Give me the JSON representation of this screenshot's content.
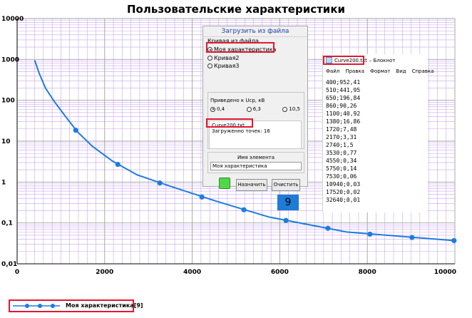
{
  "chart_data": {
    "type": "line",
    "title": "Пользовательские характеристики",
    "xlabel": "",
    "ylabel": "",
    "x_scale": "linear",
    "y_scale": "log",
    "xlim": [
      0,
      10000
    ],
    "ylim": [
      0.01,
      10000
    ],
    "x_ticks": [
      "0",
      "2000",
      "4000",
      "6000",
      "8000",
      "10000"
    ],
    "y_ticks": [
      "0,01",
      "0,1",
      "1",
      "10",
      "100",
      "1000",
      "10000"
    ],
    "grid": true,
    "legend_position": "bottom-left",
    "series": [
      {
        "name": "Моя характеристика[9]",
        "color": "#1e7be0",
        "x": [
          400,
          510,
          650,
          860,
          1100,
          1380,
          1720,
          2170,
          2740,
          3530,
          4550,
          5750,
          7530,
          10940,
          17520,
          32640
        ],
        "y": [
          952.41,
          441.95,
          196.84,
          90.26,
          40.92,
          16.86,
          7.48,
          3.31,
          1.5,
          0.77,
          0.34,
          0.14,
          0.06,
          0.03,
          0.02,
          0.01
        ],
        "markers_x": [
          1340,
          2300,
          3260,
          4220,
          5180,
          6140,
          7100,
          8060,
          9020,
          9980
        ],
        "markers_y": [
          18.5,
          2.7,
          0.95,
          0.43,
          0.21,
          0.115,
          0.074,
          0.053,
          0.044,
          0.037
        ]
      }
    ]
  },
  "dialog": {
    "header": "Загрузить из файла",
    "group_title": "Кривая из файла",
    "curves": [
      "Моя характеристика",
      "Кривая2",
      "Кривая3"
    ],
    "selected_curve": "Моя характеристика",
    "voltage_title": "Приведено к Uср, кВ",
    "voltages": [
      "0,4",
      "6,3",
      "10,5"
    ],
    "selected_voltage": "0,4",
    "file_name": "Curve200.txt",
    "points_loaded": "Загруженно точек: 16",
    "element_name_label": "Имя элемента",
    "element_name_value": "Моя характеристика",
    "assign_button": "Назначить",
    "clear_button": "Очистить",
    "count": "9"
  },
  "notepad": {
    "title_file": "Curve200.txt",
    "title_app": "– Блокнот",
    "menu": [
      "Файл",
      "Правка",
      "Формат",
      "Вид",
      "Справка"
    ],
    "lines": [
      "400;952,41",
      "510;441,95",
      "650;196,84",
      "860;90,26",
      "1100;40,92",
      "1380;16,86",
      "1720;7,48",
      "2170;3,31",
      "2740;1,5",
      "3530;0,77",
      "4550;0,34",
      "5750;0,14",
      "7530;0,06",
      "10940;0,03",
      "17520;0,02",
      "32640;0,01"
    ]
  },
  "legend": {
    "label": "Моя характеристика[9]"
  },
  "colors": {
    "line": "#1e7be0",
    "grid_minor": "#c9a6ee",
    "grid_major": "#a0a0a0",
    "highlight": "#e01830",
    "count_bg": "#1e7bd6"
  }
}
